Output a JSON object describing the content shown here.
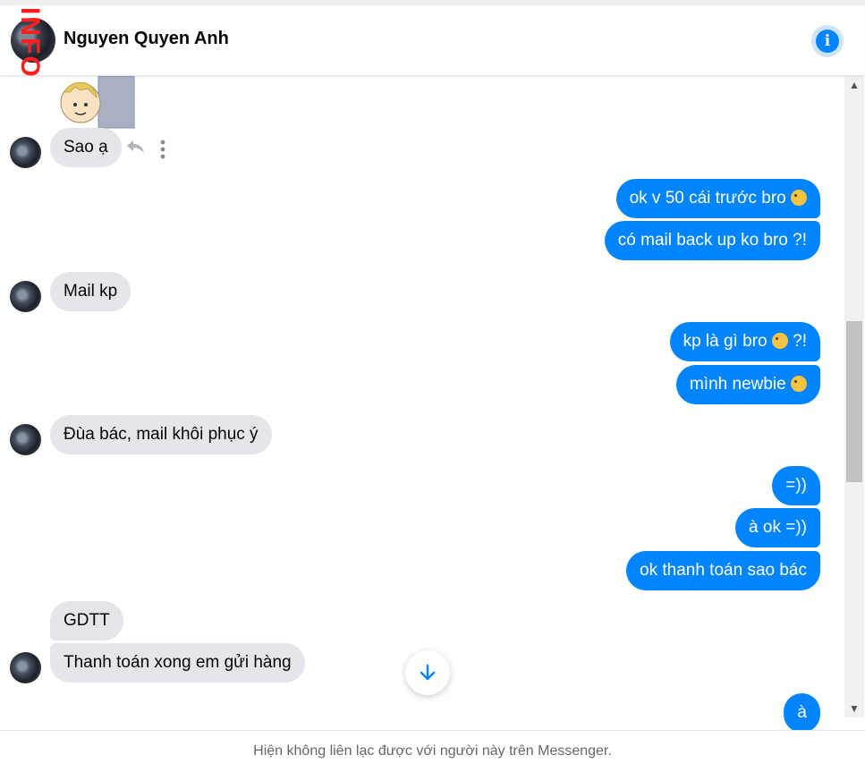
{
  "header": {
    "contact_name": "Nguyen Quyen Anh",
    "watermark": "INFO",
    "info_icon": "info-icon",
    "info_glyph": "i"
  },
  "messages": [
    {
      "id": "m1",
      "side": "in",
      "text": "Sao ạ"
    },
    {
      "id": "m2",
      "side": "out",
      "text": "ok v 50 cái trước bro",
      "emoji": "laughing-emoji"
    },
    {
      "id": "m3",
      "side": "out",
      "text": "có mail back up ko bro ?!"
    },
    {
      "id": "m4",
      "side": "in",
      "text": "Mail kp"
    },
    {
      "id": "m5",
      "side": "out",
      "text": "kp là gì bro",
      "emoji": "laughing-emoji",
      "suffix": "?!"
    },
    {
      "id": "m6",
      "side": "out",
      "text": "mình newbie",
      "emoji": "laughing-emoji"
    },
    {
      "id": "m7",
      "side": "in",
      "text": "Đùa bác, mail khôi phục ý"
    },
    {
      "id": "m8",
      "side": "out",
      "text": "=))"
    },
    {
      "id": "m9",
      "side": "out",
      "text": "à ok =))"
    },
    {
      "id": "m10",
      "side": "out",
      "text": "ok thanh toán sao bác"
    },
    {
      "id": "m11",
      "side": "in",
      "text": "GDTT"
    },
    {
      "id": "m12",
      "side": "in",
      "text": "Thanh toán xong em gửi hàng"
    },
    {
      "id": "m13",
      "side": "out",
      "text": "à"
    }
  ],
  "hover_actions": {
    "reply_icon": "reply-icon",
    "more_icon": "more-options-icon"
  },
  "scroll_down_icon": "arrow-down-icon",
  "footer": {
    "notice": "Hiện không liên lạc được với người này trên Messenger."
  },
  "colors": {
    "outgoing": "#0084ff",
    "incoming": "#e4e6eb",
    "accent": "#0084ff"
  }
}
